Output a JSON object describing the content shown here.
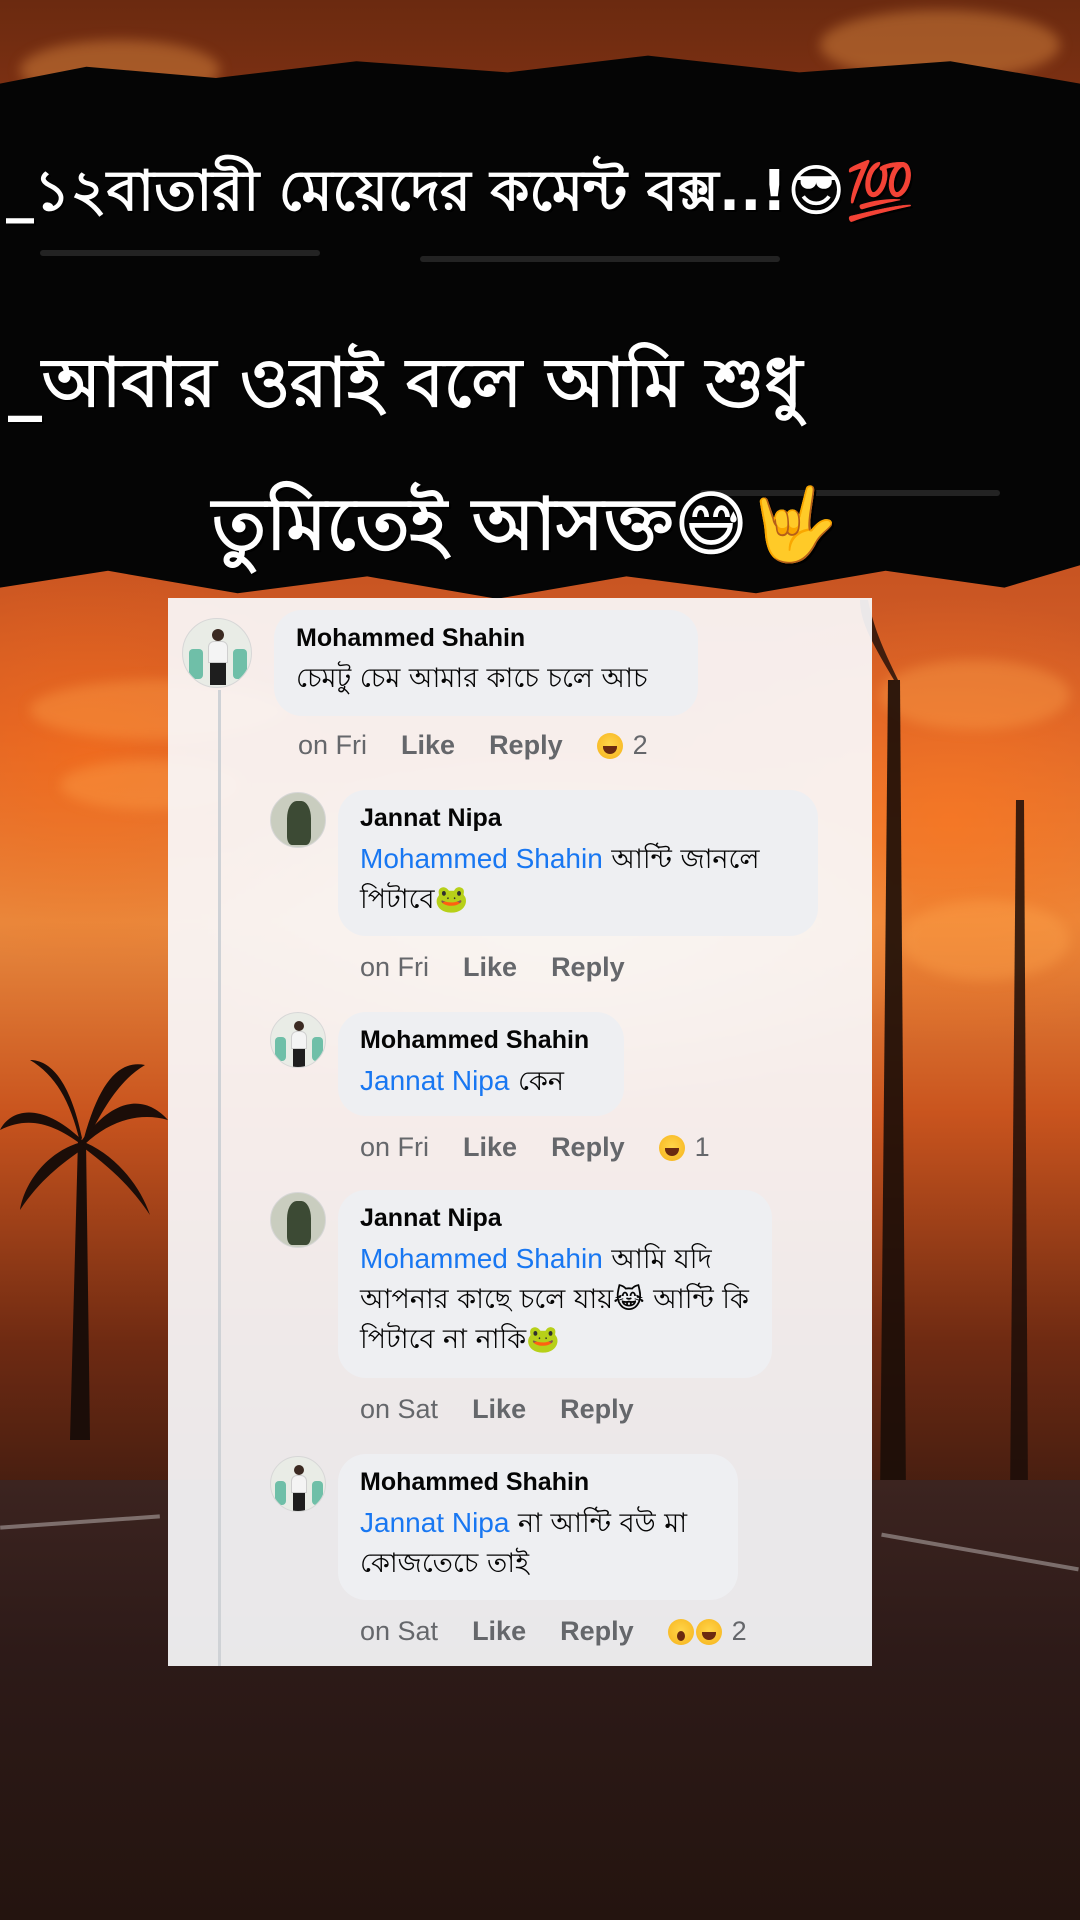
{
  "headline": {
    "line1": "_১২বাতারী মেয়েদের কমেন্ট বক্স..!😎💯",
    "line2": "_আবার ওরাই বলে আমি শুধু",
    "line3": "তুমিতেই আসক্ত😅🤟"
  },
  "comments": [
    {
      "author": "Mohammed Shahin",
      "mention": "",
      "text": "চেমটু চেম আমার কাচে চলে আচ",
      "time": "on Fri",
      "like": "Like",
      "reply": "Reply",
      "reaction_count": "2",
      "reactions": [
        "haha"
      ]
    },
    {
      "author": "Jannat Nipa",
      "mention": "Mohammed Shahin",
      "text": "আন্টি জানলে পিটাবে🐸",
      "time": "on Fri",
      "like": "Like",
      "reply": "Reply",
      "reaction_count": "",
      "reactions": []
    },
    {
      "author": "Mohammed Shahin",
      "mention": "Jannat Nipa",
      "text": "কেন",
      "time": "on Fri",
      "like": "Like",
      "reply": "Reply",
      "reaction_count": "1",
      "reactions": [
        "haha"
      ]
    },
    {
      "author": "Jannat Nipa",
      "mention": "Mohammed Shahin",
      "text": "আমি যদি আপনার কাছে চলে যায়😹 আন্টি কি পিটাবে না নাকি🐸",
      "time": "on Sat",
      "like": "Like",
      "reply": "Reply",
      "reaction_count": "",
      "reactions": []
    },
    {
      "author": "Mohammed Shahin",
      "mention": "Jannat Nipa",
      "text": "না আন্টি বউ মা কোজতেচে তাই",
      "time": "on Sat",
      "like": "Like",
      "reply": "Reply",
      "reaction_count": "2",
      "reactions": [
        "wow",
        "haha"
      ]
    }
  ],
  "icons": {
    "reaction_haha": "haha-reaction-icon",
    "reaction_wow": "wow-reaction-icon"
  }
}
